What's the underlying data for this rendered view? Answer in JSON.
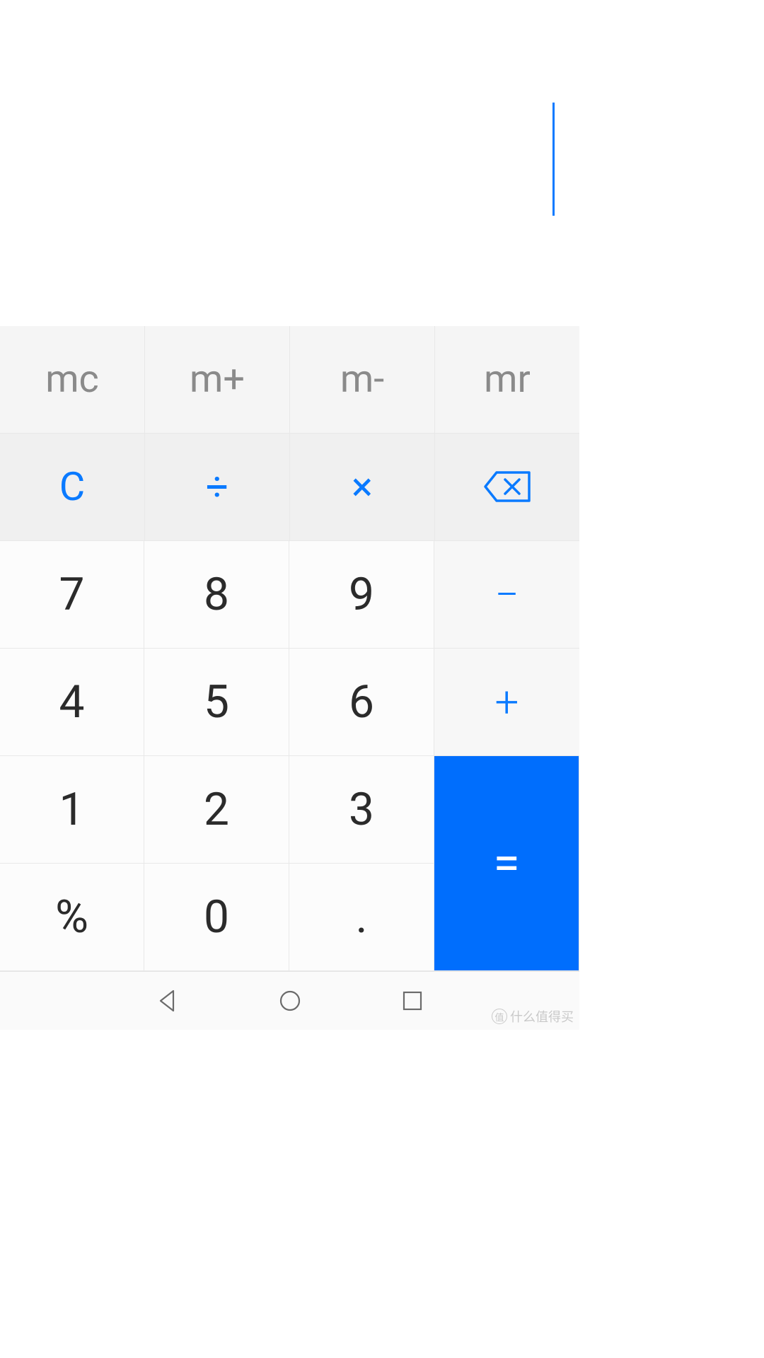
{
  "display": {
    "value": ""
  },
  "memory": {
    "mc": "mc",
    "mplus": "m+",
    "mminus": "m-",
    "mr": "mr"
  },
  "ops": {
    "clear": "C",
    "divide": "÷",
    "multiply": "×",
    "backspace": "backspace"
  },
  "digits": {
    "n7": "7",
    "n8": "8",
    "n9": "9",
    "n4": "4",
    "n5": "5",
    "n6": "6",
    "n1": "1",
    "n2": "2",
    "n3": "3",
    "n0": "0"
  },
  "side": {
    "minus": "−",
    "plus": "+",
    "equals": "="
  },
  "extra": {
    "percent": "%",
    "decimal": "."
  },
  "colors": {
    "accent": "#0a7aff",
    "equals_bg": "#006efd",
    "digit_text": "#2b2b2b",
    "memory_text": "#8a8a8a"
  },
  "watermark": {
    "text": "什么值得买",
    "badge": "值"
  }
}
